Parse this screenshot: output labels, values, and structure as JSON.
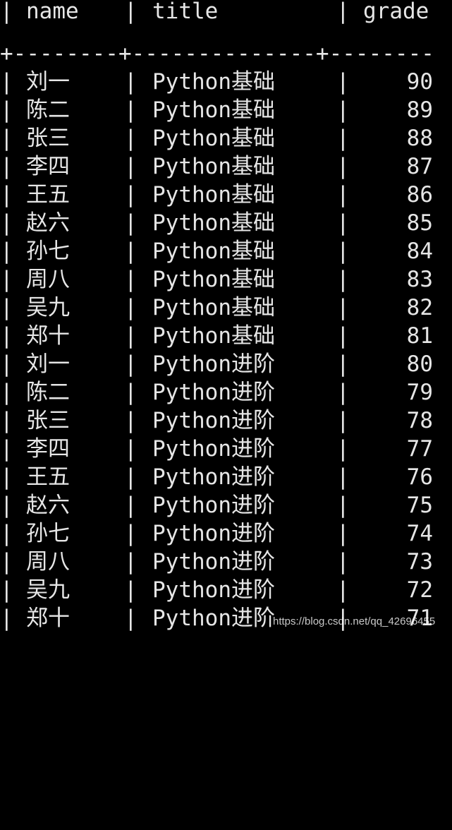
{
  "table": {
    "columns": [
      "name",
      "title",
      "grade"
    ],
    "divider": "+--------+--------------+--------",
    "rows": [
      {
        "name": "刘一",
        "title": "Python基础",
        "grade": "90"
      },
      {
        "name": "陈二",
        "title": "Python基础",
        "grade": "89"
      },
      {
        "name": "张三",
        "title": "Python基础",
        "grade": "88"
      },
      {
        "name": "李四",
        "title": "Python基础",
        "grade": "87"
      },
      {
        "name": "王五",
        "title": "Python基础",
        "grade": "86"
      },
      {
        "name": "赵六",
        "title": "Python基础",
        "grade": "85"
      },
      {
        "name": "孙七",
        "title": "Python基础",
        "grade": "84"
      },
      {
        "name": "周八",
        "title": "Python基础",
        "grade": "83"
      },
      {
        "name": "吴九",
        "title": "Python基础",
        "grade": "82"
      },
      {
        "name": "郑十",
        "title": "Python基础",
        "grade": "81"
      },
      {
        "name": "刘一",
        "title": "Python进阶",
        "grade": "80"
      },
      {
        "name": "陈二",
        "title": "Python进阶",
        "grade": "79"
      },
      {
        "name": "张三",
        "title": "Python进阶",
        "grade": "78"
      },
      {
        "name": "李四",
        "title": "Python进阶",
        "grade": "77"
      },
      {
        "name": "王五",
        "title": "Python进阶",
        "grade": "76"
      },
      {
        "name": "赵六",
        "title": "Python进阶",
        "grade": "75"
      },
      {
        "name": "孙七",
        "title": "Python进阶",
        "grade": "74"
      },
      {
        "name": "周八",
        "title": "Python进阶",
        "grade": "73"
      },
      {
        "name": "吴九",
        "title": "Python进阶",
        "grade": "72"
      },
      {
        "name": "郑十",
        "title": "Python进阶",
        "grade": "71"
      }
    ]
  },
  "watermark": "https://blog.csdn.net/qq_42696455",
  "colors": {
    "background": "#000000",
    "text": "#e6e6e6"
  }
}
